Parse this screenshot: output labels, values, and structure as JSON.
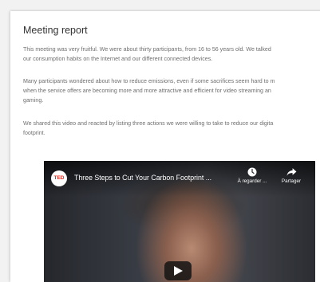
{
  "report": {
    "title": "Meeting report",
    "paragraph1": [
      "This meeting was very fruitful. We were about thirty participants, from 16 to 56 years old. We talked",
      "our consumption habits on the Internet and our different connected devices."
    ],
    "paragraph2": [
      "Many participants wondered about how to reduce emissions, even if some sacrifices seem hard to m",
      "when the service offers are becoming more and more attractive and efficient for video streaming an",
      "gaming."
    ],
    "paragraph3": [
      "We shared this video and reacted by listing three actions we were willing to take to reduce our digita",
      "footprint."
    ]
  },
  "video": {
    "channel_logo": "TED",
    "title": "Three Steps to Cut Your Carbon Footprint ...",
    "watch_later_label": "À regarder ...",
    "share_label": "Partager",
    "icons": {
      "watch_later": "clock-icon",
      "share": "share-arrow-icon",
      "play": "play-icon"
    }
  }
}
